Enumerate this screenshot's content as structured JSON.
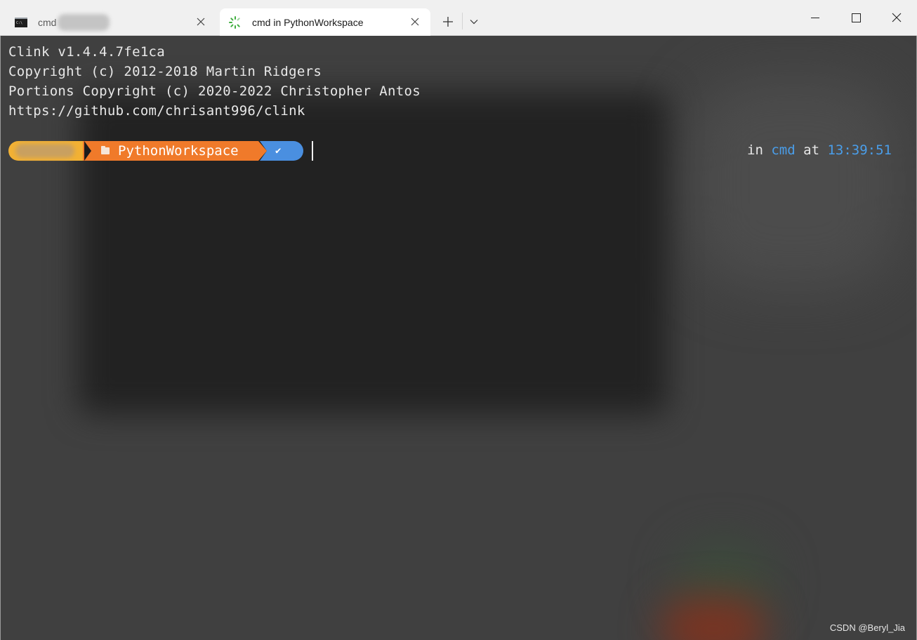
{
  "window": {
    "tabs": [
      {
        "title": "cmd",
        "active": false,
        "icon": "cmd-console-icon"
      },
      {
        "title": "cmd in PythonWorkspace",
        "active": true,
        "icon": "clink-spinner-icon"
      }
    ],
    "controls": [
      "new-tab",
      "tabs-dropdown",
      "minimize",
      "maximize",
      "close"
    ]
  },
  "terminal": {
    "lines": [
      "Clink v1.4.4.7fe1ca",
      "Copyright (c) 2012-2018 Martin Ridgers",
      "Portions Copyright (c) 2020-2022 Christopher Antos",
      "https://github.com/chrisant996/clink"
    ],
    "prompt": {
      "path": "PythonWorkspace",
      "status_symbol": "✔",
      "segment_colors": {
        "user": "#f2b134",
        "path": "#f07a2a",
        "status": "#4a8fe0"
      }
    },
    "right_prompt": {
      "in_label": "in",
      "shell": "cmd",
      "at_label": "at",
      "time": "13:39:51"
    }
  },
  "watermark": "CSDN @Beryl_Jia"
}
